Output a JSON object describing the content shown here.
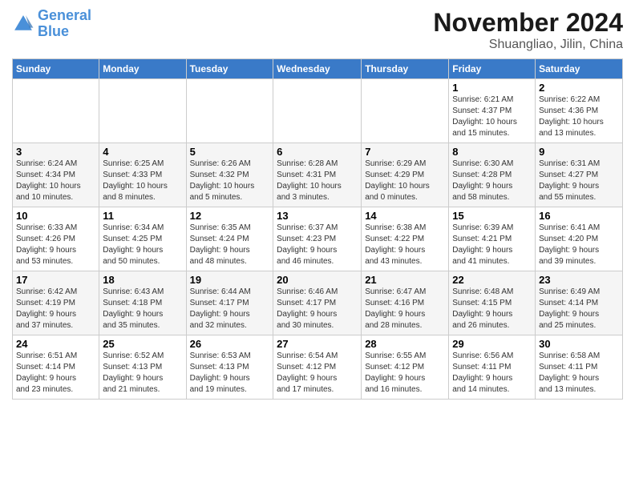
{
  "logo": {
    "line1": "General",
    "line2": "Blue"
  },
  "title": "November 2024",
  "location": "Shuangliao, Jilin, China",
  "days_of_week": [
    "Sunday",
    "Monday",
    "Tuesday",
    "Wednesday",
    "Thursday",
    "Friday",
    "Saturday"
  ],
  "weeks": [
    [
      {
        "day": "",
        "info": ""
      },
      {
        "day": "",
        "info": ""
      },
      {
        "day": "",
        "info": ""
      },
      {
        "day": "",
        "info": ""
      },
      {
        "day": "",
        "info": ""
      },
      {
        "day": "1",
        "info": "Sunrise: 6:21 AM\nSunset: 4:37 PM\nDaylight: 10 hours\nand 15 minutes."
      },
      {
        "day": "2",
        "info": "Sunrise: 6:22 AM\nSunset: 4:36 PM\nDaylight: 10 hours\nand 13 minutes."
      }
    ],
    [
      {
        "day": "3",
        "info": "Sunrise: 6:24 AM\nSunset: 4:34 PM\nDaylight: 10 hours\nand 10 minutes."
      },
      {
        "day": "4",
        "info": "Sunrise: 6:25 AM\nSunset: 4:33 PM\nDaylight: 10 hours\nand 8 minutes."
      },
      {
        "day": "5",
        "info": "Sunrise: 6:26 AM\nSunset: 4:32 PM\nDaylight: 10 hours\nand 5 minutes."
      },
      {
        "day": "6",
        "info": "Sunrise: 6:28 AM\nSunset: 4:31 PM\nDaylight: 10 hours\nand 3 minutes."
      },
      {
        "day": "7",
        "info": "Sunrise: 6:29 AM\nSunset: 4:29 PM\nDaylight: 10 hours\nand 0 minutes."
      },
      {
        "day": "8",
        "info": "Sunrise: 6:30 AM\nSunset: 4:28 PM\nDaylight: 9 hours\nand 58 minutes."
      },
      {
        "day": "9",
        "info": "Sunrise: 6:31 AM\nSunset: 4:27 PM\nDaylight: 9 hours\nand 55 minutes."
      }
    ],
    [
      {
        "day": "10",
        "info": "Sunrise: 6:33 AM\nSunset: 4:26 PM\nDaylight: 9 hours\nand 53 minutes."
      },
      {
        "day": "11",
        "info": "Sunrise: 6:34 AM\nSunset: 4:25 PM\nDaylight: 9 hours\nand 50 minutes."
      },
      {
        "day": "12",
        "info": "Sunrise: 6:35 AM\nSunset: 4:24 PM\nDaylight: 9 hours\nand 48 minutes."
      },
      {
        "day": "13",
        "info": "Sunrise: 6:37 AM\nSunset: 4:23 PM\nDaylight: 9 hours\nand 46 minutes."
      },
      {
        "day": "14",
        "info": "Sunrise: 6:38 AM\nSunset: 4:22 PM\nDaylight: 9 hours\nand 43 minutes."
      },
      {
        "day": "15",
        "info": "Sunrise: 6:39 AM\nSunset: 4:21 PM\nDaylight: 9 hours\nand 41 minutes."
      },
      {
        "day": "16",
        "info": "Sunrise: 6:41 AM\nSunset: 4:20 PM\nDaylight: 9 hours\nand 39 minutes."
      }
    ],
    [
      {
        "day": "17",
        "info": "Sunrise: 6:42 AM\nSunset: 4:19 PM\nDaylight: 9 hours\nand 37 minutes."
      },
      {
        "day": "18",
        "info": "Sunrise: 6:43 AM\nSunset: 4:18 PM\nDaylight: 9 hours\nand 35 minutes."
      },
      {
        "day": "19",
        "info": "Sunrise: 6:44 AM\nSunset: 4:17 PM\nDaylight: 9 hours\nand 32 minutes."
      },
      {
        "day": "20",
        "info": "Sunrise: 6:46 AM\nSunset: 4:17 PM\nDaylight: 9 hours\nand 30 minutes."
      },
      {
        "day": "21",
        "info": "Sunrise: 6:47 AM\nSunset: 4:16 PM\nDaylight: 9 hours\nand 28 minutes."
      },
      {
        "day": "22",
        "info": "Sunrise: 6:48 AM\nSunset: 4:15 PM\nDaylight: 9 hours\nand 26 minutes."
      },
      {
        "day": "23",
        "info": "Sunrise: 6:49 AM\nSunset: 4:14 PM\nDaylight: 9 hours\nand 25 minutes."
      }
    ],
    [
      {
        "day": "24",
        "info": "Sunrise: 6:51 AM\nSunset: 4:14 PM\nDaylight: 9 hours\nand 23 minutes."
      },
      {
        "day": "25",
        "info": "Sunrise: 6:52 AM\nSunset: 4:13 PM\nDaylight: 9 hours\nand 21 minutes."
      },
      {
        "day": "26",
        "info": "Sunrise: 6:53 AM\nSunset: 4:13 PM\nDaylight: 9 hours\nand 19 minutes."
      },
      {
        "day": "27",
        "info": "Sunrise: 6:54 AM\nSunset: 4:12 PM\nDaylight: 9 hours\nand 17 minutes."
      },
      {
        "day": "28",
        "info": "Sunrise: 6:55 AM\nSunset: 4:12 PM\nDaylight: 9 hours\nand 16 minutes."
      },
      {
        "day": "29",
        "info": "Sunrise: 6:56 AM\nSunset: 4:11 PM\nDaylight: 9 hours\nand 14 minutes."
      },
      {
        "day": "30",
        "info": "Sunrise: 6:58 AM\nSunset: 4:11 PM\nDaylight: 9 hours\nand 13 minutes."
      }
    ]
  ]
}
